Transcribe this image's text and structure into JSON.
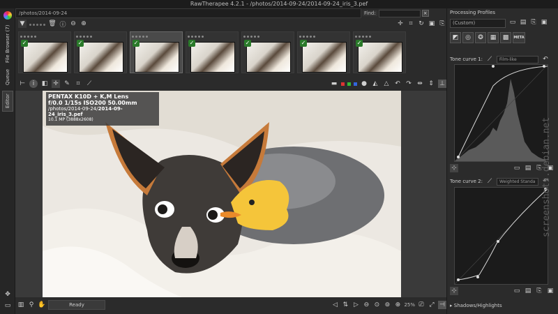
{
  "window": {
    "title": "RawTherapee 4.2.1 - /photos/2014-09-24/2014-09-24_iris_3.pef"
  },
  "left_tabs": [
    {
      "label": "File Browser (7)"
    },
    {
      "label": "Queue"
    },
    {
      "label": "Editor"
    }
  ],
  "path_bar": {
    "value": "/photos/2014-09-24"
  },
  "find": {
    "label": "Find:",
    "value": ""
  },
  "thumbnails": [
    {
      "name": "thumb-1"
    },
    {
      "name": "thumb-2"
    },
    {
      "name": "thumb-3",
      "selected": true
    },
    {
      "name": "thumb-4"
    },
    {
      "name": "thumb-5"
    },
    {
      "name": "thumb-6"
    },
    {
      "name": "thumb-7"
    }
  ],
  "info_overlay": {
    "camera": "PENTAX K10D + K,M Lens",
    "exposure": "f/0.0  1/15s  ISO200  50.00mm",
    "path_prefix": "/photos/2014-09-24/",
    "file": "2014-09-24_iris_3.pef",
    "size": "10.1 MP (3888x2608)"
  },
  "status": {
    "text": "Ready",
    "zoom": "25%"
  },
  "right_panel": {
    "title": "Processing Profiles",
    "profile": "(Custom)",
    "tabs": {
      "meta": "META"
    },
    "curve1": {
      "label": "Tone curve 1:",
      "mode": "Film-like"
    },
    "curve2": {
      "label": "Tone curve 2:",
      "mode": "Weighted Standa"
    },
    "section": "Shadows/Highlights"
  },
  "watermark": "screenshots.debian.net"
}
